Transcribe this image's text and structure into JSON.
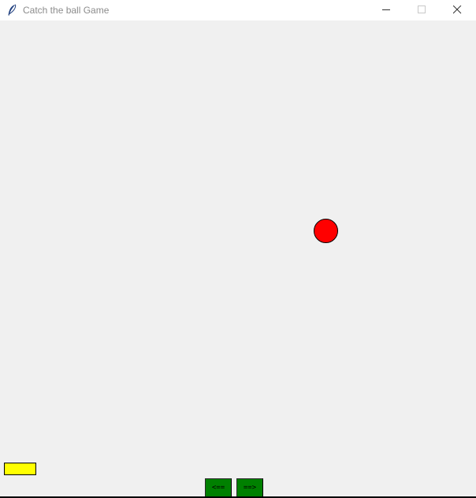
{
  "window": {
    "title": "Catch the ball Game",
    "app_icon": "feather-icon",
    "controls": [
      "minimize-icon",
      "maximize-icon",
      "close-icon"
    ]
  },
  "game": {
    "ball": {
      "color": "#ff0000"
    },
    "paddle": {
      "color": "#ffff00"
    },
    "background_color": "#f0f0f0",
    "buttons": {
      "left_label": "<==",
      "right_label": "==>",
      "color": "#008000"
    }
  }
}
